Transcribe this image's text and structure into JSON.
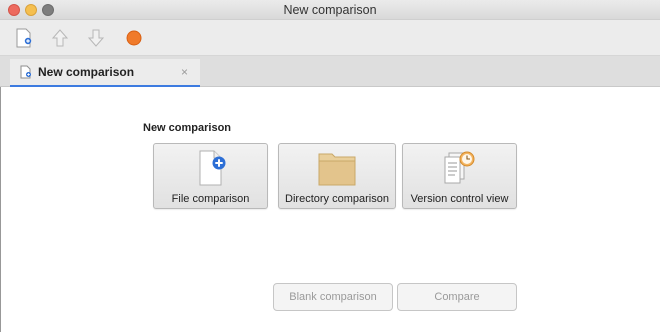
{
  "window": {
    "title": "New comparison"
  },
  "toolbar": {
    "buttons": [
      {
        "icon": "new-document-icon"
      },
      {
        "icon": "arrow-up-icon"
      },
      {
        "icon": "arrow-down-icon"
      },
      {
        "icon": "stop-icon",
        "color": "#f07a2a"
      }
    ]
  },
  "tabs": [
    {
      "label": "New comparison",
      "close": "×",
      "active": true
    }
  ],
  "main": {
    "heading": "New comparison",
    "options": [
      {
        "label": "File comparison",
        "icon": "file-add-icon"
      },
      {
        "label": "Directory comparison",
        "icon": "folder-icon"
      },
      {
        "label": "Version control view",
        "icon": "version-history-icon"
      }
    ],
    "actions": {
      "blank": "Blank comparison",
      "compare": "Compare"
    }
  },
  "colors": {
    "accent": "#3d7be0",
    "folder": "#e3c48c",
    "orange": "#f07a2a"
  }
}
